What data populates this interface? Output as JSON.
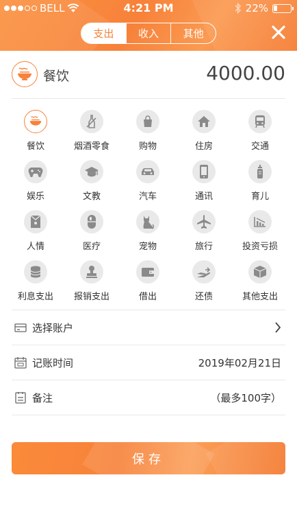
{
  "status_bar": {
    "carrier": "BELL",
    "time": "4:21 PM",
    "battery": "22%"
  },
  "tabs": [
    {
      "label": "支出",
      "active": true
    },
    {
      "label": "收入",
      "active": false
    },
    {
      "label": "其他",
      "active": false
    }
  ],
  "selected": {
    "name": "餐饮",
    "amount": "4000.00",
    "icon": "noodle-bowl-icon"
  },
  "categories": [
    {
      "label": "餐饮",
      "icon": "noodle-bowl-icon"
    },
    {
      "label": "烟酒零食",
      "icon": "bottle-icon"
    },
    {
      "label": "购物",
      "icon": "shopping-bag-icon"
    },
    {
      "label": "住房",
      "icon": "house-icon"
    },
    {
      "label": "交通",
      "icon": "bus-icon"
    },
    {
      "label": "娱乐",
      "icon": "gamepad-icon"
    },
    {
      "label": "文教",
      "icon": "graduation-cap-icon"
    },
    {
      "label": "汽车",
      "icon": "car-icon"
    },
    {
      "label": "通讯",
      "icon": "phone-icon"
    },
    {
      "label": "育儿",
      "icon": "baby-bottle-icon"
    },
    {
      "label": "人情",
      "icon": "envelope-icon"
    },
    {
      "label": "医疗",
      "icon": "pill-icon"
    },
    {
      "label": "宠物",
      "icon": "cat-icon"
    },
    {
      "label": "旅行",
      "icon": "airplane-icon"
    },
    {
      "label": "投资亏损",
      "icon": "chart-down-icon"
    },
    {
      "label": "利息支出",
      "icon": "coins-icon"
    },
    {
      "label": "报销支出",
      "icon": "stamp-icon"
    },
    {
      "label": "借出",
      "icon": "wallet-icon"
    },
    {
      "label": "还债",
      "icon": "hand-money-icon"
    },
    {
      "label": "其他支出",
      "icon": "box-icon"
    }
  ],
  "form": {
    "account_label": "选择账户",
    "time_label": "记账时间",
    "time_value": "2019年02月21日",
    "note_label": "备注",
    "note_placeholder": "（最多100字）"
  },
  "save_label": "保存",
  "colors": {
    "accent": "#f7823a",
    "icon_gray": "#8a8a8a",
    "circle_bg": "#e9e9e9"
  }
}
